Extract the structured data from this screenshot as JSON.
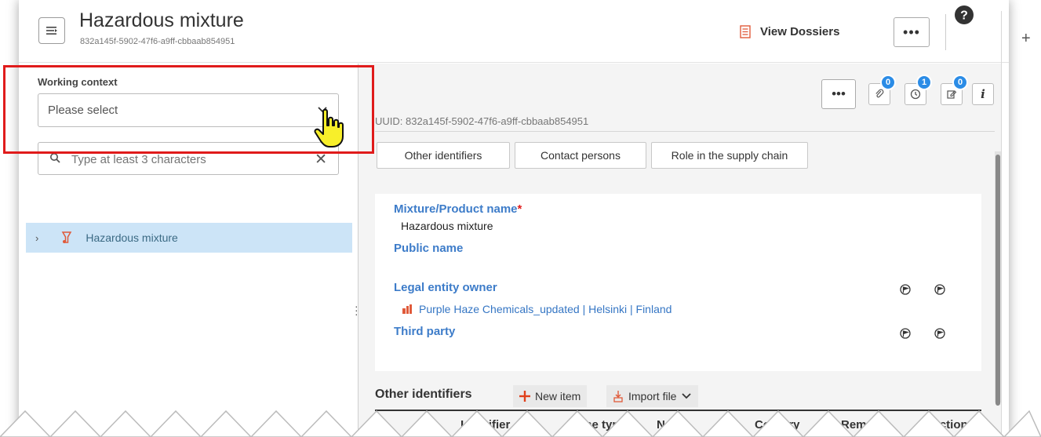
{
  "header": {
    "title": "Hazardous mixture",
    "uuid": "832a145f-5902-47f6-a9ff-cbbaab854951",
    "view_dossiers": "View Dossiers",
    "more": "•••",
    "help": "?",
    "outside_plus": "+"
  },
  "left": {
    "working_context_label": "Working context",
    "working_context_value": "Please select",
    "search_placeholder": "Type at least 3 characters",
    "tree_item": "Hazardous mixture"
  },
  "right": {
    "more": "•••",
    "badges": {
      "attachments": "0",
      "history": "1",
      "tasks": "0"
    },
    "info": "i",
    "uuid_text": "UUID: 832a145f-5902-47f6-a9ff-cbbaab854951",
    "tabs": [
      "Other identifiers",
      "Contact persons",
      "Role in the supply chain"
    ],
    "fields": {
      "mixture_name_label": "Mixture/Product name",
      "mixture_name_required": "*",
      "mixture_name_value": "Hazardous mixture",
      "public_name_label": "Public name",
      "legal_entity_label": "Legal entity owner",
      "legal_entity_value": "Purple Haze Chemicals_updated | Helsinki | Finland",
      "third_party_label": "Third party"
    },
    "section": {
      "title": "Other identifiers",
      "new_item": "New item",
      "import_file": "Import file"
    },
    "table_headers": [
      "#",
      "Identifier",
      "Name type",
      "Name",
      "Country",
      "Remarks",
      "Actions"
    ]
  },
  "colors": {
    "accent_blue": "#3d7cc9",
    "highlight_red": "#e01b1b",
    "badge_blue": "#2b8ce6",
    "tree_selected": "#cce4f7"
  }
}
